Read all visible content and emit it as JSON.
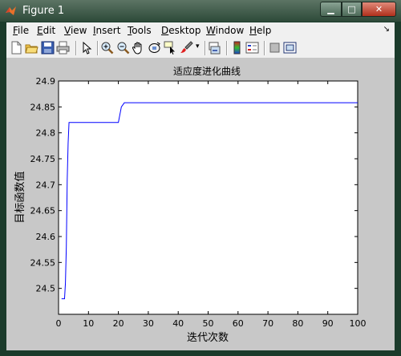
{
  "window": {
    "title": "Figure 1",
    "title_color": "#ffffff"
  },
  "titlebar_buttons": {
    "minimize_glyph": "▁",
    "maximize_glyph": "□",
    "close_glyph": "✕"
  },
  "menu": {
    "items": [
      {
        "label": "File",
        "accel": "F",
        "rest": "ile"
      },
      {
        "label": "Edit",
        "accel": "E",
        "rest": "dit"
      },
      {
        "label": "View",
        "accel": "V",
        "rest": "iew"
      },
      {
        "label": "Insert",
        "accel": "I",
        "rest": "nsert"
      },
      {
        "label": "Tools",
        "accel": "T",
        "rest": "ools"
      },
      {
        "label": "Desktop",
        "accel": "D",
        "rest": "esktop"
      },
      {
        "label": "Window",
        "accel": "W",
        "rest": "indow"
      },
      {
        "label": "Help",
        "accel": "H",
        "rest": "elp"
      }
    ],
    "overflow_glyph": "↘"
  },
  "toolbar": {
    "icons": [
      "new-figure-icon",
      "open-file-icon",
      "save-icon",
      "print-icon",
      "edit-plot-icon",
      "zoom-in-icon",
      "zoom-out-icon",
      "pan-icon",
      "rotate-3d-icon",
      "data-cursor-icon",
      "brush-icon",
      "link-plot-icon",
      "colorbar-icon",
      "legend-icon",
      "hide-plot-tools-icon",
      "show-plot-tools-icon"
    ]
  },
  "colors": {
    "line": "#0000ff",
    "figure_bg": "#c8c8c8",
    "axes_bg": "#ffffff"
  },
  "chart_data": {
    "type": "line",
    "title": "适应度进化曲线",
    "xlabel": "迭代次数",
    "ylabel": "目标函数值",
    "xlim": [
      0,
      100
    ],
    "ylim": [
      24.45,
      24.9
    ],
    "xticks": [
      0,
      10,
      20,
      30,
      40,
      50,
      60,
      70,
      80,
      90,
      100
    ],
    "yticks": [
      24.5,
      24.55,
      24.6,
      24.65,
      24.7,
      24.75,
      24.8,
      24.85,
      24.9
    ],
    "ytick_labels": [
      "24.5",
      "24.55",
      "24.6",
      "24.65",
      "24.7",
      "24.75",
      "24.8",
      "24.85",
      "24.9"
    ],
    "grid": false,
    "series": [
      {
        "x": [
          1,
          2,
          2.3,
          2.6,
          2.9,
          3.2,
          3.5,
          20,
          21,
          22,
          100
        ],
        "y": [
          24.48,
          24.48,
          24.51,
          24.58,
          24.71,
          24.78,
          24.82,
          24.82,
          24.85,
          24.858,
          24.858
        ]
      }
    ]
  }
}
